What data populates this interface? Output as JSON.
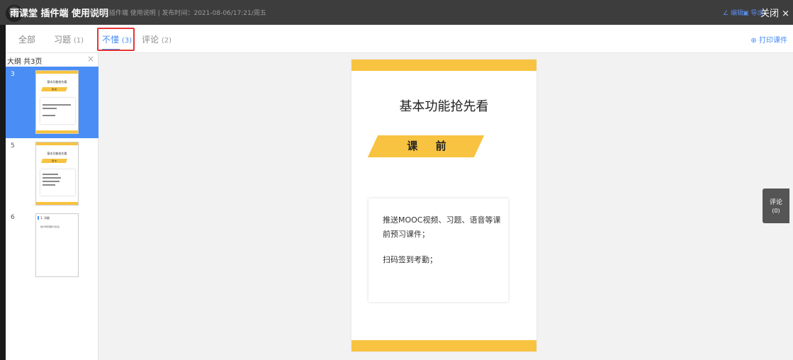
{
  "header": {
    "title": "雨课堂 插件端 使用说明",
    "subtitle": "雨课堂 插件端 使用说明  |  发布时间：2021-08-06/17:21/周五",
    "edit_label": "编辑",
    "export_label": "导出",
    "close_label": "关闭 ×"
  },
  "tabs": [
    {
      "label": "全部",
      "count": ""
    },
    {
      "label": "习题",
      "count": "(1)"
    },
    {
      "label": "不懂",
      "count": "(3)"
    },
    {
      "label": "评论",
      "count": "(2)"
    }
  ],
  "active_tab_index": 2,
  "print_label": "打印课件",
  "sidebar": {
    "title": "大纲 共3页",
    "close": "×",
    "thumbnails": [
      {
        "page": "3",
        "active": true,
        "title": "基本功能抢先看",
        "banner": "课 前"
      },
      {
        "page": "5",
        "active": false,
        "title": "基本功能抢先看",
        "banner": "课 中"
      },
      {
        "page": "6",
        "active": false,
        "heading": "1. 功能",
        "text": "用户预览课件与标注"
      }
    ]
  },
  "slide": {
    "title": "基本功能抢先看",
    "banner": "课 前",
    "line1": "推送MOOC视频、习题、语音等课前预习课件；",
    "line2": "扫码签到考勤；"
  },
  "comment_tab": {
    "label": "评论",
    "count": "(0)"
  },
  "colors": {
    "accent": "#4a8ef5",
    "highlight_box": "#e53535",
    "slide_yellow": "#f7c340",
    "topbar": "#3d3d3d"
  }
}
